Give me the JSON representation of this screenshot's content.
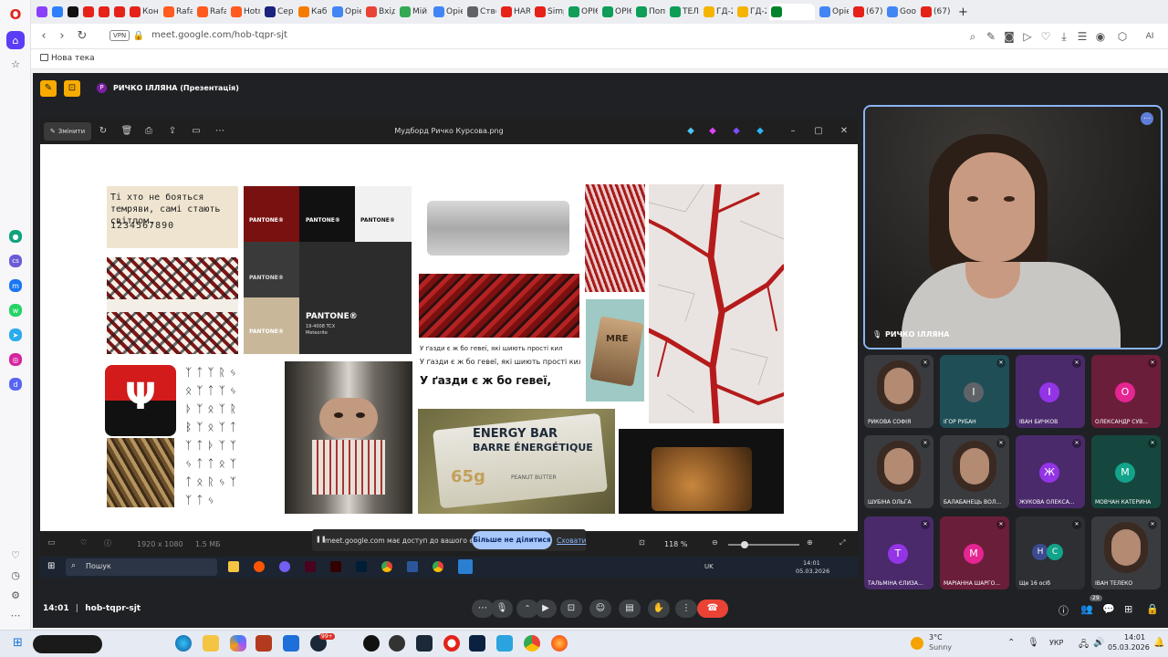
{
  "browser": {
    "tabs": [
      {
        "label": "",
        "color": "#8a3ffc"
      },
      {
        "label": "",
        "color": "#2d7ff9"
      },
      {
        "label": "",
        "color": "#111111"
      },
      {
        "label": "",
        "color": "#e62117"
      },
      {
        "label": "",
        "color": "#e62117"
      },
      {
        "label": "",
        "color": "#e62117"
      },
      {
        "label": "Конк",
        "color": "#e62117"
      },
      {
        "label": "Rafa",
        "color": "#ff5a1f"
      },
      {
        "label": "Rafa",
        "color": "#ff5a1f"
      },
      {
        "label": "Hotn",
        "color": "#ff5a1f"
      },
      {
        "label": "Сер",
        "color": "#1a237e"
      },
      {
        "label": "Кабі",
        "color": "#f57c00"
      },
      {
        "label": "Opie",
        "color": "#4285f4"
      },
      {
        "label": "Вхід",
        "color": "#ea4335"
      },
      {
        "label": "Мій",
        "color": "#34a853"
      },
      {
        "label": "Opie",
        "color": "#4285f4"
      },
      {
        "label": "Стве",
        "color": "#5f6368"
      },
      {
        "label": "HARG",
        "color": "#e62117"
      },
      {
        "label": "Simp",
        "color": "#e62117"
      },
      {
        "label": "ОРІЄ",
        "color": "#0f9d58"
      },
      {
        "label": "ОРІЄ",
        "color": "#0f9d58"
      },
      {
        "label": "Попе",
        "color": "#0f9d58"
      },
      {
        "label": "ТЕЛІ",
        "color": "#0f9d58"
      },
      {
        "label": "ГД-2",
        "color": "#f4b400"
      },
      {
        "label": "ГД-2",
        "color": "#f4b400"
      },
      {
        "label": "",
        "color": "#00832d"
      },
      {
        "label": "Opie",
        "color": "#4285f4"
      },
      {
        "label": "(67)",
        "color": "#e62117"
      },
      {
        "label": "Goog",
        "color": "#4285f4"
      },
      {
        "label": "(67)",
        "color": "#e62117"
      }
    ],
    "new_tab": "+",
    "vpn_badge": "VPN",
    "url": "meet.google.com/hob-tqpr-sjt",
    "bookmark_folder": "Нова тека",
    "ai_label": "AI"
  },
  "meet": {
    "presenter_initial": "Р",
    "presentation_title": "РИЧКО ІЛЛЯНА (Презентація)",
    "meeting_code": "hob-tqpr-sjt",
    "time": "14:01",
    "participant_count": "29",
    "main_speaker": "РИЧКО ІЛЛЯНА",
    "participants": [
      {
        "name": "РИКОВА СОФІЯ",
        "initial": "",
        "bg": "#3a3b3f",
        "avatar": ""
      },
      {
        "name": "ІГОР РУБАН",
        "initial": "І",
        "bg": "#1f4e57",
        "avatar": "#5f6368"
      },
      {
        "name": "ІВАН БИЧКОВ",
        "initial": "І",
        "bg": "#4a2a6b",
        "avatar": "#9334e6"
      },
      {
        "name": "ОЛЕКСАНДР СУВ...",
        "initial": "О",
        "bg": "#6b1e3a",
        "avatar": "#e52592"
      },
      {
        "name": "ШУБІНА ОЛЬГА",
        "initial": "",
        "bg": "#3a3b3f",
        "avatar": ""
      },
      {
        "name": "БАЛАБАНЕЦЬ ВОЛ...",
        "initial": "",
        "bg": "#3a3b3f",
        "avatar": ""
      },
      {
        "name": "ЖУКОВА ОЛЕКСА...",
        "initial": "Ж",
        "bg": "#4a2a6b",
        "avatar": "#9334e6"
      },
      {
        "name": "МОВЧАН КАТЕРИНА",
        "initial": "М",
        "bg": "#16473f",
        "avatar": "#12a48a"
      },
      {
        "name": "ТАЛЬМІНА ЄЛИЗА...",
        "initial": "Т",
        "bg": "#4a2a6b",
        "avatar": "#9334e6"
      },
      {
        "name": "МАРІАННА ШАРГО...",
        "initial": "М",
        "bg": "#6b1e3a",
        "avatar": "#e52592"
      },
      {
        "name": "Ще 16 осіб",
        "initial": "",
        "bg": "#2d2f33",
        "avatar": ""
      },
      {
        "name": "ІВАН ТЕЛЕКО",
        "initial": "",
        "bg": "#3a3b3f",
        "avatar": ""
      }
    ],
    "more_initials": [
      "Н",
      "С"
    ],
    "share_notice": {
      "message": "meet.google.com має доступ до вашого екрана.",
      "stop": "Більше не ділитися",
      "hide": "Сховати"
    }
  },
  "viewer": {
    "edit_label": "Змінити",
    "file_title": "Мудборд Ричко Курсова.png",
    "dimensions": "1920 x 1080",
    "file_size": "1.5 МБ",
    "zoom": "118 %"
  },
  "moodboard": {
    "quote": "Ті хто не бояться темряви, самі стають світлом.",
    "digits": "1234567890",
    "pantone_brand": "PANTONE®",
    "pantone_big": "PANTONE®",
    "pantone_code": "19-4008 TCX",
    "pantone_name": "Meteorite",
    "font_line1": "У ґазди є ж бо гевеї, які шиють прості кил",
    "font_line2": "У ґазди є ж бо гевеї, які шиють прості кил",
    "font_line3": "У ґазди є ж бо гевеї,",
    "mre": "MRE",
    "energy1": "ENERGY BAR",
    "energy2": "BARRE ÉNERGÉTIQUE",
    "energy3": "65g",
    "energy4": "PEANUT BUTTER"
  },
  "inner_taskbar": {
    "search": "Пошук",
    "lang": "UK",
    "time": "14:01",
    "date": "05.03.2026"
  },
  "taskbar": {
    "weather_temp": "3°C",
    "weather_desc": "Sunny",
    "lang": "УКР",
    "time": "14:01",
    "date": "05.03.2026",
    "badge": "99+"
  }
}
